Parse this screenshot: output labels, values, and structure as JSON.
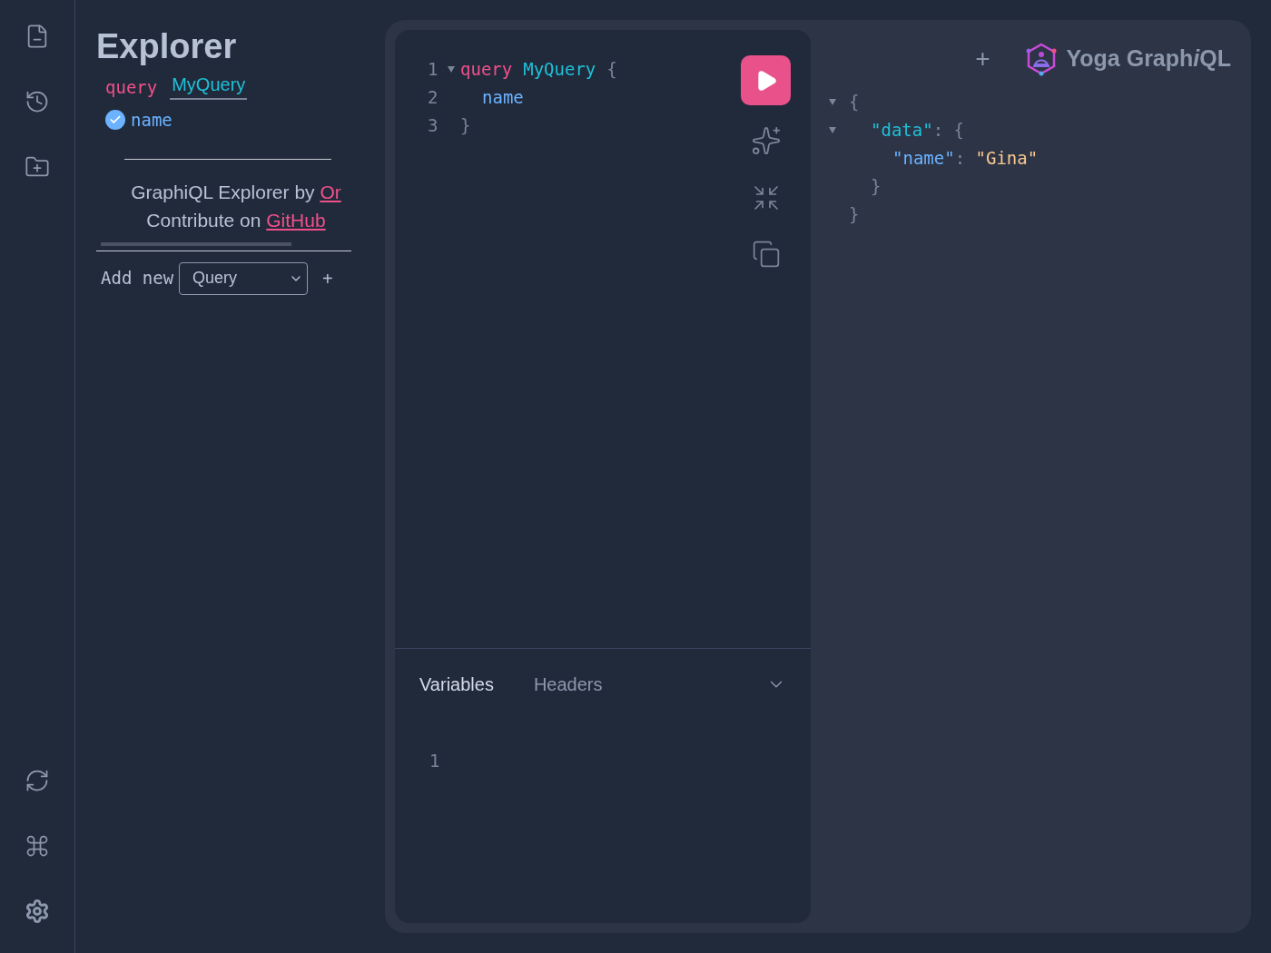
{
  "explorer": {
    "title": "Explorer",
    "operation": {
      "keyword": "query",
      "name": "MyQuery"
    },
    "fields": [
      {
        "name": "name",
        "checked": true
      }
    ],
    "credit": {
      "text": "GraphiQL Explorer by ",
      "link": "Or"
    },
    "contribute": {
      "text": "Contribute on ",
      "link": "GitHub"
    },
    "add_new": {
      "label": "Add new",
      "select_value": "Query",
      "plus": "+"
    }
  },
  "editor": {
    "lines": [
      {
        "number": "1",
        "foldable": true,
        "tokens": [
          {
            "kind": "keyword",
            "text": "query"
          },
          {
            "kind": "def",
            "text": "MyQuery"
          },
          {
            "kind": "punct",
            "text": "{"
          }
        ],
        "children": [
          {
            "number": "2",
            "foldable": false,
            "tokens": [
              {
                "kind": "field",
                "text": "name"
              }
            ]
          }
        ]
      },
      {
        "number": "3",
        "foldable": false,
        "tokens": [
          {
            "kind": "punct",
            "text": "}"
          }
        ]
      }
    ]
  },
  "bottom_tabs": [
    {
      "label": "Variables",
      "selected": true
    },
    {
      "label": "Headers",
      "selected": false
    }
  ],
  "variables": {
    "lines": [
      {
        "number": "1"
      }
    ]
  },
  "header": {
    "plus": "+",
    "logo_text": "Yoga Graph",
    "logo_italic": "i",
    "logo_end": "QL"
  },
  "result": {
    "lines": [
      {
        "foldable": true,
        "tokens": [
          {
            "kind": "punct",
            "text": "{"
          }
        ],
        "children": [
          {
            "foldable": true,
            "tokens": [
              {
                "kind": "key",
                "text": "\"data\""
              },
              {
                "kind": "punct",
                "text": ": {"
              }
            ],
            "children": [
              {
                "foldable": false,
                "tokens": [
                  {
                    "kind": "field",
                    "text": "\"name\""
                  },
                  {
                    "kind": "punct",
                    "text": ": "
                  },
                  {
                    "kind": "string",
                    "text": "\"Gina\""
                  }
                ]
              }
            ]
          },
          {
            "foldable": false,
            "tokens": [
              {
                "kind": "punct",
                "text": "}"
              }
            ]
          }
        ]
      },
      {
        "foldable": false,
        "tokens": [
          {
            "kind": "punct",
            "text": "}"
          }
        ]
      }
    ]
  }
}
